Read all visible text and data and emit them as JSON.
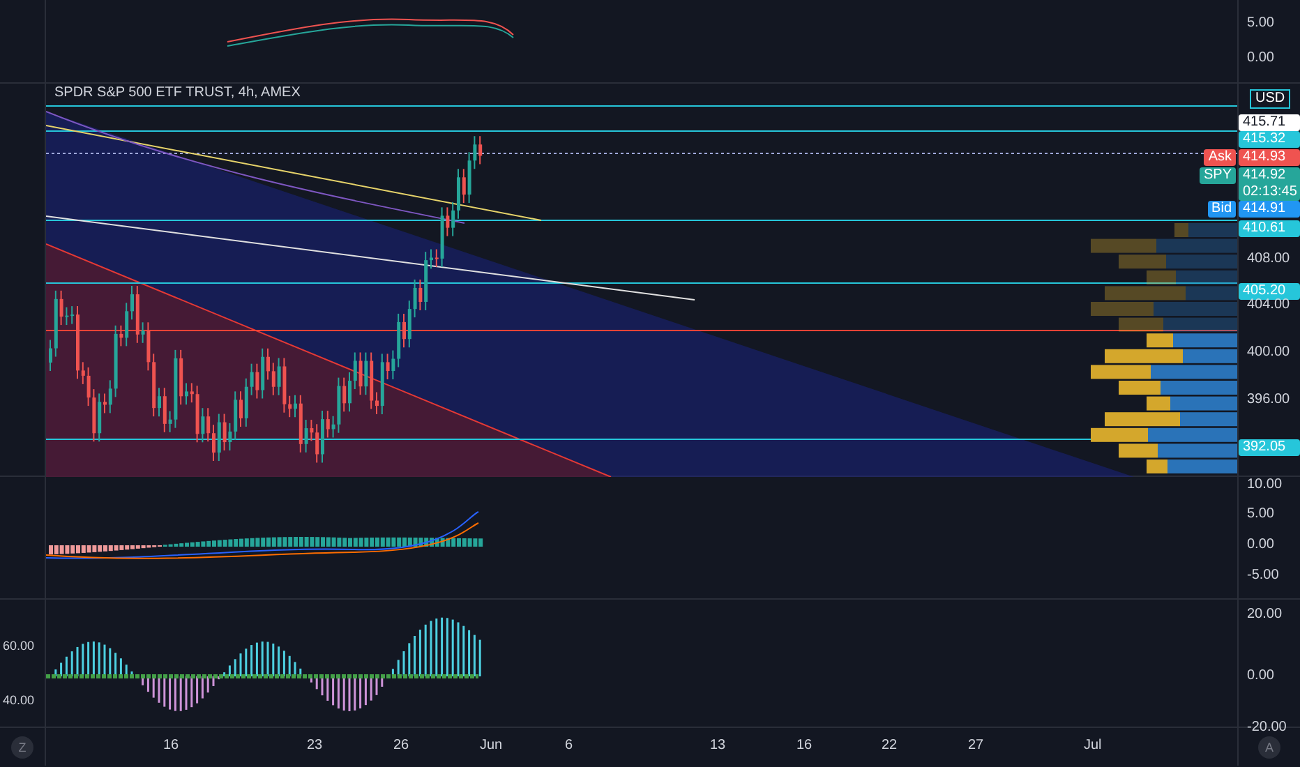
{
  "chart_title": "SPDR S&P 500 ETF TRUST, 4h, AMEX",
  "top_pane": {
    "axis_labels": [
      "5.00",
      "0.00"
    ]
  },
  "main_pane": {
    "currency": "USD",
    "axis_labels": [
      {
        "text": "415.71",
        "kind": "badge",
        "color": "#ffffff"
      },
      {
        "text": "415.32",
        "kind": "badge",
        "color": "#26c6da"
      },
      {
        "text": "414.93",
        "kind": "badge",
        "color": "#ef5350"
      },
      {
        "text": "414.92",
        "sub": "02:13:45",
        "kind": "badge",
        "color": "#26a69a"
      },
      {
        "text": "414.91",
        "kind": "badge",
        "color": "#2196f3"
      },
      {
        "text": "410.61",
        "kind": "badge",
        "color": "#26c6da"
      },
      {
        "text": "408.00",
        "kind": "plain"
      },
      {
        "text": "405.20",
        "kind": "badge",
        "color": "#26c6da"
      },
      {
        "text": "404.00",
        "kind": "plain"
      },
      {
        "text": "400.00",
        "kind": "plain"
      },
      {
        "text": "396.00",
        "kind": "plain"
      },
      {
        "text": "392.05",
        "kind": "badge",
        "color": "#26c6da"
      }
    ],
    "tags": [
      {
        "text": "Ask",
        "color": "#ef5350"
      },
      {
        "text": "SPY",
        "color": "#26a69a"
      },
      {
        "text": "Bid",
        "color": "#2196f3"
      }
    ]
  },
  "macd_pane": {
    "axis_labels": [
      "10.00",
      "5.00",
      "0.00",
      "-5.00"
    ]
  },
  "rsi_pane": {
    "left_labels": [
      "60.00",
      "40.00"
    ],
    "axis_labels": [
      "20.00",
      "0.00",
      "-20.00"
    ]
  },
  "time_axis": {
    "labels": [
      "16",
      "23",
      "26",
      "Jun",
      "6",
      "13",
      "16",
      "22",
      "27",
      "Jul"
    ]
  },
  "corner_buttons": [
    "Z",
    "A"
  ]
}
